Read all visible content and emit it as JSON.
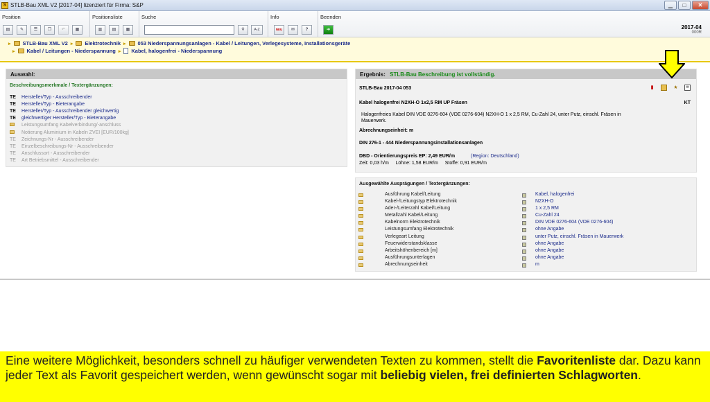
{
  "window": {
    "app_icon": "S",
    "title": "STLB-Bau XML V2 [2017-04] lizenziert für Firma: S&P",
    "minimize": "▁",
    "maximize": "□",
    "close": "✕"
  },
  "toolbar": {
    "groups": {
      "position": "Position",
      "positionsliste": "Positionsliste",
      "suche": "Suche",
      "info": "Info",
      "beenden": "Beenden"
    },
    "search_value": "",
    "search_button_az": "A-Z",
    "info_button_neu": "NEU",
    "version": "2017-04",
    "version_sub": "000R"
  },
  "breadcrumb": {
    "row1": [
      "STLB-Bau XML V2",
      "Elektrotechnik",
      "053 Niederspannungsanlagen - Kabel / Leitungen, Verlegesysteme, Installationsgeräte"
    ],
    "row2": [
      "Kabel / Leitungen - Niederspannung",
      "Kabel, halogenfrei - Niederspannung"
    ]
  },
  "left_panel": {
    "title": "Auswahl:",
    "subtitle": "Beschreibungsmerkmale / Textergänzungen:",
    "items": [
      {
        "tag": "TE",
        "text": "Hersteller/Typ - Ausschreibender",
        "active": true
      },
      {
        "tag": "TE",
        "text": "Hersteller/Typ - Bieterangabe",
        "active": true
      },
      {
        "tag": "TE",
        "text": "Hersteller/Typ - Ausschreibender gleichwertig",
        "active": true
      },
      {
        "tag": "TE",
        "text": "gleichwertiger Hersteller/Typ - Bieterangabe",
        "active": true
      },
      {
        "tag": "",
        "text": "Leistungsumfang Kabelverbindung/-anschluss",
        "active": false
      },
      {
        "tag": "",
        "text": "Notierung Aluminium in Kabeln ZVEI [EUR/100kg]",
        "active": false
      },
      {
        "tag": "TE",
        "text": "Zeichnungs-Nr - Ausschreibender",
        "active": false
      },
      {
        "tag": "TE",
        "text": "Einzelbeschreibungs-Nr - Ausschreibender",
        "active": false
      },
      {
        "tag": "TE",
        "text": "Anschlussort - Ausschreibender",
        "active": false
      },
      {
        "tag": "TE",
        "text": "Art Betriebsmittel - Ausschreibender",
        "active": false
      }
    ]
  },
  "result": {
    "label": "Ergebnis:",
    "status": "STLB-Bau Beschreibung ist vollständig.",
    "code": "STLB-Bau 2017-04 053",
    "item_title": "Kabel halogenfrei N2XH-O 1x2,5 RM UP Fräsen",
    "unit_short": "KT",
    "description_1": "Halogenfreies Kabel DIN VDE 0276-604 (VDE 0276-604) N2XH-O 1 x 2,5 RM, Cu-Zahl 24, unter Putz, einschl. Fräsen in",
    "description_2": "Mauerwerk.",
    "billing_unit": "Abrechnungseinheit: m",
    "din": "DIN 276-1 - 444 Niederspannungsinstallationsanlagen",
    "price": "DBD - Orientierungspreis EP: 2,49 EUR/m",
    "region": "(Region: Deutschland)",
    "time_line": "Zeit: 0,03 h/m     Löhne: 1,58 EUR/m     Stoffe: 0,91 EUR/m",
    "icons": [
      "red-flag-icon",
      "folder-icon",
      "star-icon",
      "mail-icon"
    ]
  },
  "selected": {
    "title": "Ausgewählte Ausprägungen / Textergänzungen:",
    "rows": [
      {
        "label": "Ausführung Kabel/Leitung",
        "value": "Kabel, halogenfrei"
      },
      {
        "label": "Kabel-/Leitungstyp Elektrotechnik",
        "value": "N2XH-O"
      },
      {
        "label": "Ader-/Leiterzahl Kabel/Leitung",
        "value": "1 x 2,5 RM"
      },
      {
        "label": "Metallzahl Kabel/Leitung",
        "value": "Cu-Zahl 24"
      },
      {
        "label": "Kabelnorm Elektrotechnik",
        "value": "DIN VDE 0276-604 (VDE 0276-604)"
      },
      {
        "label": "Leistungsumfang Elektrotechnik",
        "value": "ohne Angabe"
      },
      {
        "label": "Verlegeart Leitung",
        "value": "unter Putz, einschl. Fräsen in Mauerwerk"
      },
      {
        "label": "Feuerwiderstandsklasse",
        "value": "ohne Angabe"
      },
      {
        "label": "Arbeitshöhenbereich [m]",
        "value": "ohne Angabe"
      },
      {
        "label": "Ausführungsunterlagen",
        "value": "ohne Angabe"
      },
      {
        "label": "Abrechnungseinheit",
        "value": "m"
      }
    ]
  },
  "caption": {
    "part1": "Eine weitere Möglichkeit, besonders schnell zu häufiger verwendeten Texten zu kommen, stellt die ",
    "bold1": "Favoritenliste",
    "part2": " dar. Dazu kann jeder Text als Favorit gespeichert werden, wenn gewünscht sogar mit ",
    "bold2": "beliebig vielen, frei definierten Schlagworten",
    "part3": "."
  },
  "colors": {
    "caption_bg": "#ffff00",
    "breadcrumb_bg": "#fffbdc",
    "status_green": "#1a8a1a",
    "link_blue": "#1a2a8a",
    "arrow_yellow": "#ffff00"
  }
}
